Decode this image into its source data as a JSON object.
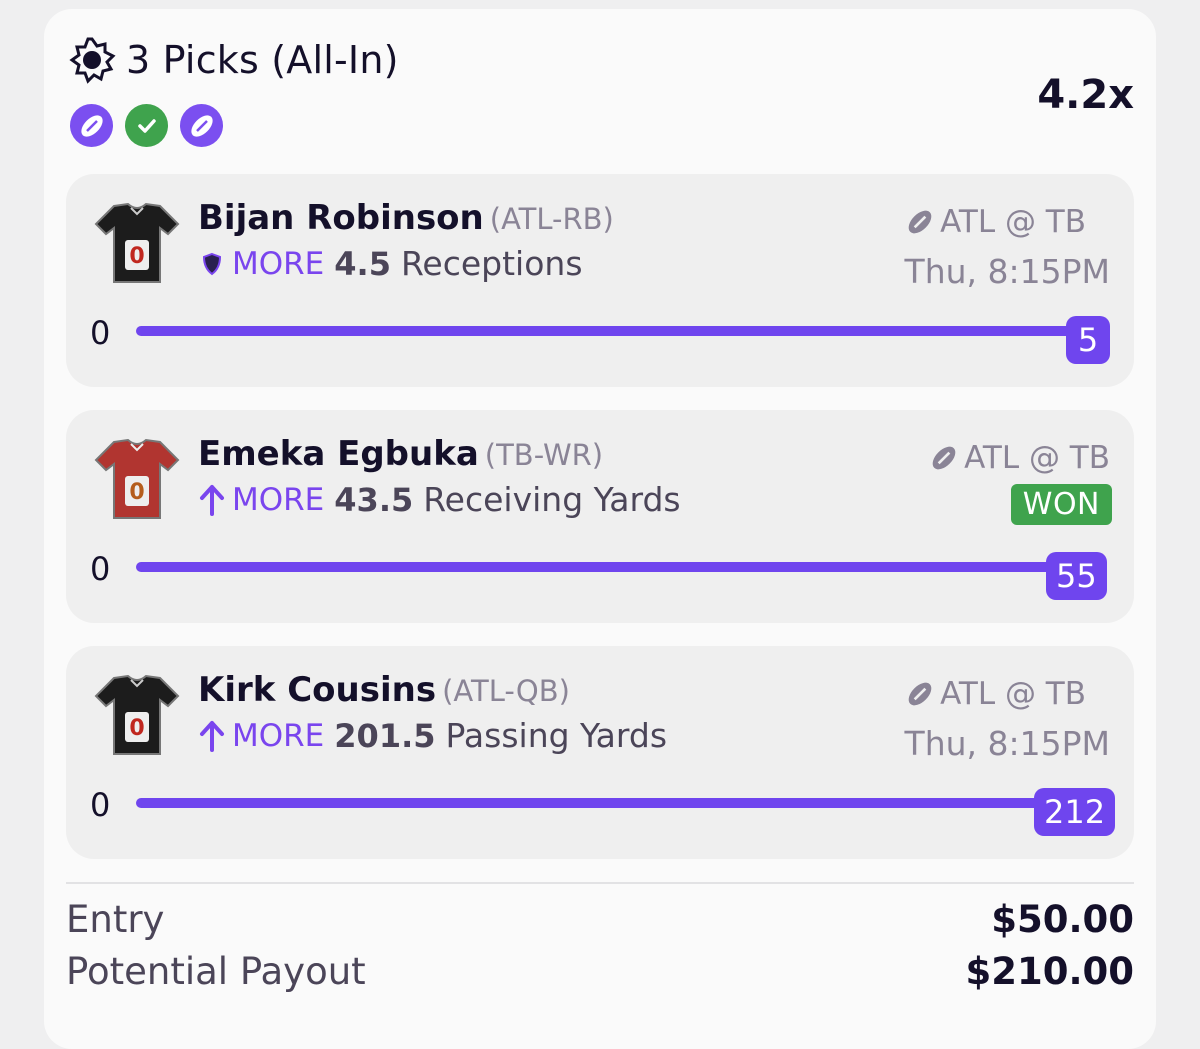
{
  "header": {
    "title": "3 Picks (All-In)",
    "title_icon": "sun-gear-icon",
    "multiplier": "4.2x",
    "badges": [
      {
        "icon": "football-icon",
        "color": "#7b4ff0"
      },
      {
        "icon": "check-icon",
        "color": "#3fa34d"
      },
      {
        "icon": "football-icon",
        "color": "#7b4ff0"
      }
    ]
  },
  "picks": [
    {
      "player": "Bijan Robinson",
      "position": "(ATL-RB)",
      "direction_icon": "shield-icon",
      "direction": "MORE",
      "line": "4.5",
      "stat": "Receptions",
      "matchup": "ATL @ TB",
      "time": "Thu, 8:15PM",
      "result": "",
      "progress_min": "0",
      "progress_value": "5",
      "jersey_color": "#1c1c1c"
    },
    {
      "player": "Emeka Egbuka",
      "position": "(TB-WR)",
      "direction_icon": "arrow-up-icon",
      "direction": "MORE",
      "line": "43.5",
      "stat": "Receiving Yards",
      "matchup": "ATL @ TB",
      "time": "",
      "result": "WON",
      "progress_min": "0",
      "progress_value": "55",
      "jersey_color": "#b13530"
    },
    {
      "player": "Kirk Cousins",
      "position": "(ATL-QB)",
      "direction_icon": "arrow-up-icon",
      "direction": "MORE",
      "line": "201.5",
      "stat": "Passing Yards",
      "matchup": "ATL @ TB",
      "time": "Thu, 8:15PM",
      "result": "",
      "progress_min": "0",
      "progress_value": "212",
      "jersey_color": "#1c1c1c"
    }
  ],
  "summary": {
    "entry_label": "Entry",
    "entry_value": "$50.00",
    "payout_label": "Potential Payout",
    "payout_value": "$210.00"
  },
  "colors": {
    "accent": "#6f45ee",
    "won": "#3fa34d",
    "muted": "#8a8496"
  }
}
